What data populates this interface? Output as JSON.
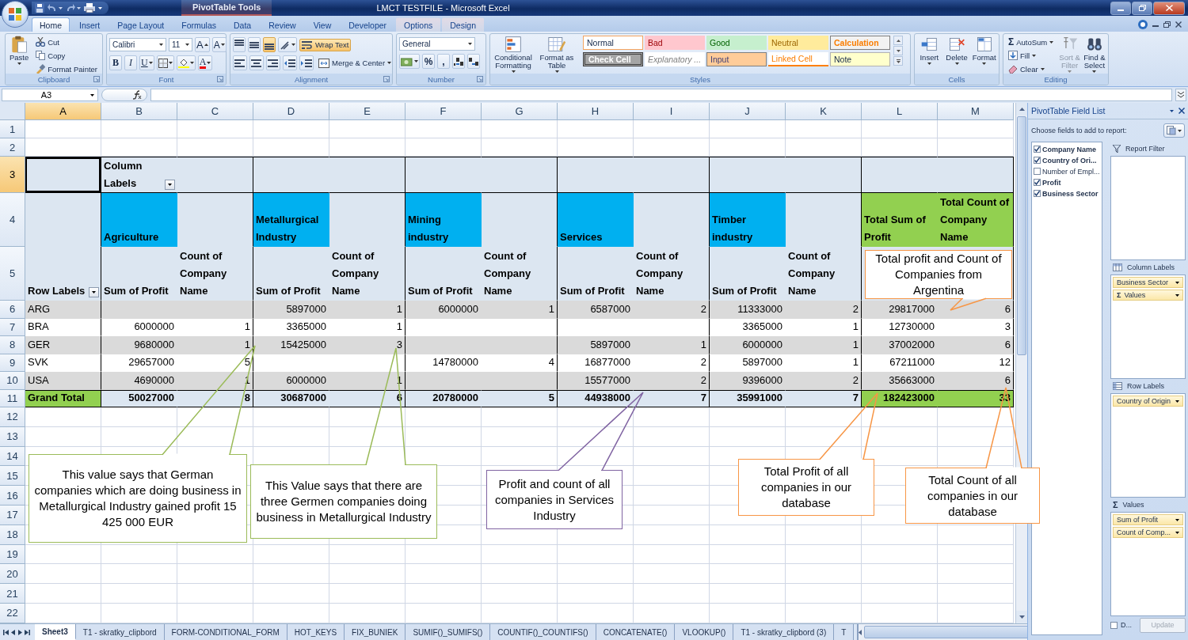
{
  "title_bar": {
    "context_label": "PivotTable Tools",
    "title": "LMCT TESTFILE - Microsoft Excel"
  },
  "ribbon": {
    "tabs": [
      {
        "label": "Home",
        "selected": true,
        "contextual": false
      },
      {
        "label": "Insert",
        "selected": false,
        "contextual": false
      },
      {
        "label": "Page Layout",
        "selected": false,
        "contextual": false
      },
      {
        "label": "Formulas",
        "selected": false,
        "contextual": false
      },
      {
        "label": "Data",
        "selected": false,
        "contextual": false
      },
      {
        "label": "Review",
        "selected": false,
        "contextual": false
      },
      {
        "label": "View",
        "selected": false,
        "contextual": false
      },
      {
        "label": "Developer",
        "selected": false,
        "contextual": false
      },
      {
        "label": "Options",
        "selected": false,
        "contextual": true
      },
      {
        "label": "Design",
        "selected": false,
        "contextual": true
      }
    ],
    "groups": [
      {
        "kind": "clipboard",
        "label": "Clipboard",
        "paste": "Paste",
        "items": [
          "Cut",
          "Copy",
          "Format Painter"
        ]
      },
      {
        "kind": "font",
        "label": "Font",
        "font_name": "Calibri",
        "font_size": "11",
        "grow": "A",
        "shrink": "A",
        "bold": "B",
        "italic": "I",
        "underline": "U",
        "font_color": "A"
      },
      {
        "kind": "alignment",
        "label": "Alignment",
        "align_buttons": [
          {
            "kind": "top",
            "selected": false
          },
          {
            "kind": "middle",
            "selected": false
          },
          {
            "kind": "bottom",
            "selected": true
          }
        ],
        "wrap": {
          "label": "Wrap Text",
          "selected": true
        },
        "merge": "Merge & Center"
      },
      {
        "kind": "number",
        "label": "Number",
        "format": "General",
        "percent": "%",
        "comma": ","
      },
      {
        "kind": "styles",
        "label": "Styles",
        "buttons": [
          "Conditional Formatting",
          "Format as Table"
        ],
        "cell_styles": [
          {
            "label": "Normal",
            "kind": "normal"
          },
          {
            "label": "Bad",
            "kind": "bad"
          },
          {
            "label": "Good",
            "kind": "good"
          },
          {
            "label": "Neutral",
            "kind": "neutral"
          },
          {
            "label": "Calculation",
            "kind": "calculation"
          },
          {
            "label": "Check Cell",
            "kind": "check"
          },
          {
            "label": "Explanatory ...",
            "kind": "explanatory"
          },
          {
            "label": "Input",
            "kind": "input"
          },
          {
            "label": "Linked Cell",
            "kind": "linked"
          },
          {
            "label": "Note",
            "kind": "note"
          }
        ]
      },
      {
        "kind": "cells",
        "label": "Cells",
        "buttons": [
          "Insert",
          "Delete",
          "Format"
        ]
      },
      {
        "kind": "editing",
        "label": "Editing",
        "symbol": "Σ",
        "items": [
          "AutoSum",
          "Fill",
          "Clear"
        ],
        "sort": {
          "label": "Sort & Filter",
          "disabled": true
        },
        "find": "Find & Select"
      }
    ]
  },
  "formula_bar": {
    "name_box": "A3"
  },
  "sheet": {
    "columns": [
      "A",
      "B",
      "C",
      "D",
      "E",
      "F",
      "G",
      "H",
      "I",
      "J",
      "K",
      "L",
      "M"
    ],
    "rows": [
      {
        "number": "1",
        "kind": "blank"
      },
      {
        "number": "2",
        "kind": "blank"
      },
      {
        "number": "3",
        "kind": "caption",
        "cells": [
          {
            "kind": "head",
            "selected": true
          },
          {
            "kind": "head",
            "text": "Column Labels",
            "filter": true
          },
          {
            "kind": "head"
          },
          {
            "kind": "head"
          },
          {
            "kind": "head"
          },
          {
            "kind": "head"
          },
          {
            "kind": "head"
          },
          {
            "kind": "head"
          },
          {
            "kind": "head"
          },
          {
            "kind": "head"
          },
          {
            "kind": "head"
          },
          {
            "kind": "head"
          },
          {
            "kind": "head"
          }
        ]
      },
      {
        "number": "4",
        "kind": "header",
        "cells": [
          {
            "kind": "head"
          },
          {
            "kind": "sector",
            "text": "Agriculture"
          },
          {
            "kind": "head"
          },
          {
            "kind": "sector",
            "text": "Metallurgical Industry"
          },
          {
            "kind": "head"
          },
          {
            "kind": "sector",
            "text": "Mining industry"
          },
          {
            "kind": "head"
          },
          {
            "kind": "sector",
            "text": "Services"
          },
          {
            "kind": "head"
          },
          {
            "kind": "sector",
            "text": "Timber industry"
          },
          {
            "kind": "head"
          },
          {
            "kind": "sum-head",
            "text": "Total Sum of Profit"
          },
          {
            "kind": "sum-head",
            "text": "Total Count of Company Name"
          }
        ]
      },
      {
        "number": "5",
        "kind": "header",
        "cells": [
          {
            "kind": "head",
            "text": "Row Labels",
            "filter": true
          },
          {
            "kind": "head",
            "text": "Sum of Profit"
          },
          {
            "kind": "head",
            "text": "Count of Company Name"
          },
          {
            "kind": "head",
            "text": "Sum of Profit"
          },
          {
            "kind": "head",
            "text": "Count of Company Name"
          },
          {
            "kind": "head",
            "text": "Sum of Profit"
          },
          {
            "kind": "head",
            "text": "Count of Company Name"
          },
          {
            "kind": "head",
            "text": "Sum of Profit"
          },
          {
            "kind": "head",
            "text": "Count of Company Name"
          },
          {
            "kind": "head",
            "text": "Sum of Profit"
          },
          {
            "kind": "head",
            "text": "Count of Company Name"
          },
          {
            "kind": "head"
          },
          {
            "kind": "head"
          }
        ]
      },
      {
        "number": "6",
        "kind": "band",
        "cells": [
          {
            "kind": "label",
            "text": "ARG"
          },
          {
            "kind": "num"
          },
          {
            "kind": "num"
          },
          {
            "kind": "num",
            "text": "5897000"
          },
          {
            "kind": "num",
            "text": "1"
          },
          {
            "kind": "num",
            "text": "6000000"
          },
          {
            "kind": "num",
            "text": "1"
          },
          {
            "kind": "num",
            "text": "6587000"
          },
          {
            "kind": "num",
            "text": "2"
          },
          {
            "kind": "num",
            "text": "11333000"
          },
          {
            "kind": "num",
            "text": "2"
          },
          {
            "kind": "num",
            "text": "29817000"
          },
          {
            "kind": "num",
            "text": "6"
          }
        ]
      },
      {
        "number": "7",
        "kind": "plain",
        "cells": [
          {
            "kind": "label",
            "text": "BRA"
          },
          {
            "kind": "num",
            "text": "6000000"
          },
          {
            "kind": "num",
            "text": "1"
          },
          {
            "kind": "num",
            "text": "3365000"
          },
          {
            "kind": "num",
            "text": "1"
          },
          {
            "kind": "num"
          },
          {
            "kind": "num"
          },
          {
            "kind": "num"
          },
          {
            "kind": "num"
          },
          {
            "kind": "num",
            "text": "3365000"
          },
          {
            "kind": "num",
            "text": "1"
          },
          {
            "kind": "num",
            "text": "12730000"
          },
          {
            "kind": "num",
            "text": "3"
          }
        ]
      },
      {
        "number": "8",
        "kind": "band",
        "cells": [
          {
            "kind": "label",
            "text": "GER"
          },
          {
            "kind": "num",
            "text": "9680000"
          },
          {
            "kind": "num",
            "text": "1"
          },
          {
            "kind": "num",
            "text": "15425000"
          },
          {
            "kind": "num",
            "text": "3"
          },
          {
            "kind": "num"
          },
          {
            "kind": "num"
          },
          {
            "kind": "num",
            "text": "5897000"
          },
          {
            "kind": "num",
            "text": "1"
          },
          {
            "kind": "num",
            "text": "6000000"
          },
          {
            "kind": "num",
            "text": "1"
          },
          {
            "kind": "num",
            "text": "37002000"
          },
          {
            "kind": "num",
            "text": "6"
          }
        ]
      },
      {
        "number": "9",
        "kind": "plain",
        "cells": [
          {
            "kind": "label",
            "text": "SVK"
          },
          {
            "kind": "num",
            "text": "29657000"
          },
          {
            "kind": "num",
            "text": "5"
          },
          {
            "kind": "num"
          },
          {
            "kind": "num"
          },
          {
            "kind": "num",
            "text": "14780000"
          },
          {
            "kind": "num",
            "text": "4"
          },
          {
            "kind": "num",
            "text": "16877000"
          },
          {
            "kind": "num",
            "text": "2"
          },
          {
            "kind": "num",
            "text": "5897000"
          },
          {
            "kind": "num",
            "text": "1"
          },
          {
            "kind": "num",
            "text": "67211000"
          },
          {
            "kind": "num",
            "text": "12"
          }
        ]
      },
      {
        "number": "10",
        "kind": "band",
        "cells": [
          {
            "kind": "label",
            "text": "USA"
          },
          {
            "kind": "num",
            "text": "4690000"
          },
          {
            "kind": "num",
            "text": "1"
          },
          {
            "kind": "num",
            "text": "6000000"
          },
          {
            "kind": "num",
            "text": "1"
          },
          {
            "kind": "num"
          },
          {
            "kind": "num"
          },
          {
            "kind": "num",
            "text": "15577000"
          },
          {
            "kind": "num",
            "text": "2"
          },
          {
            "kind": "num",
            "text": "9396000"
          },
          {
            "kind": "num",
            "text": "2"
          },
          {
            "kind": "num",
            "text": "35663000"
          },
          {
            "kind": "num",
            "text": "6"
          }
        ]
      },
      {
        "number": "11",
        "kind": "grand",
        "cells": [
          {
            "kind": "grand-label",
            "text": "Grand Total"
          },
          {
            "kind": "grand-num",
            "text": "50027000"
          },
          {
            "kind": "grand-num",
            "text": "8"
          },
          {
            "kind": "grand-num",
            "text": "30687000"
          },
          {
            "kind": "grand-num",
            "text": "6"
          },
          {
            "kind": "grand-num",
            "text": "20780000"
          },
          {
            "kind": "grand-num",
            "text": "5"
          },
          {
            "kind": "grand-num",
            "text": "44938000"
          },
          {
            "kind": "grand-num",
            "text": "7"
          },
          {
            "kind": "grand-num",
            "text": "35991000"
          },
          {
            "kind": "grand-num",
            "text": "7"
          },
          {
            "kind": "grand-sum",
            "text": "182423000"
          },
          {
            "kind": "grand-sum",
            "text": "33"
          }
        ]
      },
      {
        "number": "12",
        "kind": "blank"
      },
      {
        "number": "13",
        "kind": "blank"
      },
      {
        "number": "14",
        "kind": "blank"
      },
      {
        "number": "15",
        "kind": "blank"
      },
      {
        "number": "16",
        "kind": "blank"
      },
      {
        "number": "17",
        "kind": "blank"
      },
      {
        "number": "18",
        "kind": "blank"
      },
      {
        "number": "19",
        "kind": "blank"
      },
      {
        "number": "20",
        "kind": "blank"
      },
      {
        "number": "21",
        "kind": "blank"
      },
      {
        "number": "22",
        "kind": "blank"
      }
    ]
  },
  "callouts": [
    {
      "text": "Total profit and Count of Companies from Argentina",
      "color": "#f79646"
    },
    {
      "text": "This value says that German companies which are doing business in Metallurgical Industry gained profit 15 425 000 EUR",
      "color": "#9bbb59"
    },
    {
      "text": "This Value says that there are three Germen companies doing business in Metallurgical Industry",
      "color": "#9bbb59"
    },
    {
      "text": "Profit and count of all companies in Services Industry",
      "color": "#8064a2"
    },
    {
      "text": "Total Profit of all companies in our database",
      "color": "#f79646"
    },
    {
      "text": "Total Count of all companies in our database",
      "color": "#f79646"
    }
  ],
  "sheet_tabs": [
    {
      "label": "Sheet3",
      "selected": true
    },
    {
      "label": "T1 - skratky_clipbord",
      "selected": false
    },
    {
      "label": "FORM-CONDITIONAL_FORM",
      "selected": false
    },
    {
      "label": "HOT_KEYS",
      "selected": false
    },
    {
      "label": "FIX_BUNIEK",
      "selected": false
    },
    {
      "label": "SUMIF()_SUMIFS()",
      "selected": false
    },
    {
      "label": "COUNTIF()_COUNTIFS()",
      "selected": false
    },
    {
      "label": "CONCATENATE()",
      "selected": false
    },
    {
      "label": "VLOOKUP()",
      "selected": false
    },
    {
      "label": "T1 - skratky_clipbord (3)",
      "selected": false
    },
    {
      "label": "T",
      "selected": false
    }
  ],
  "field_list": {
    "title": "PivotTable Field List",
    "prompt": "Choose fields to add to report:",
    "fields": [
      {
        "label": "Company Name",
        "checked": true
      },
      {
        "label": "Country of Ori...",
        "checked": true
      },
      {
        "label": "Number of Empl...",
        "checked": false
      },
      {
        "label": "Profit",
        "checked": true
      },
      {
        "label": "Business Sector",
        "checked": true
      }
    ],
    "areas": [
      {
        "kind": "filter",
        "label": "Report Filter"
      },
      {
        "kind": "columns",
        "label": "Column Labels",
        "items": [
          {
            "label": "Business Sector"
          },
          {
            "label": "Values",
            "symbol": "Σ"
          }
        ]
      },
      {
        "kind": "rows",
        "label": "Row Labels",
        "items": [
          {
            "label": "Country of Origin"
          }
        ]
      },
      {
        "kind": "values",
        "label": "Values",
        "symbol": "Σ",
        "items": [
          {
            "label": "Sum of Profit"
          },
          {
            "label": "Count of Comp..."
          }
        ]
      }
    ],
    "defer": {
      "label": "D...",
      "checked": false
    },
    "update": {
      "label": "Update",
      "disabled": true
    }
  }
}
